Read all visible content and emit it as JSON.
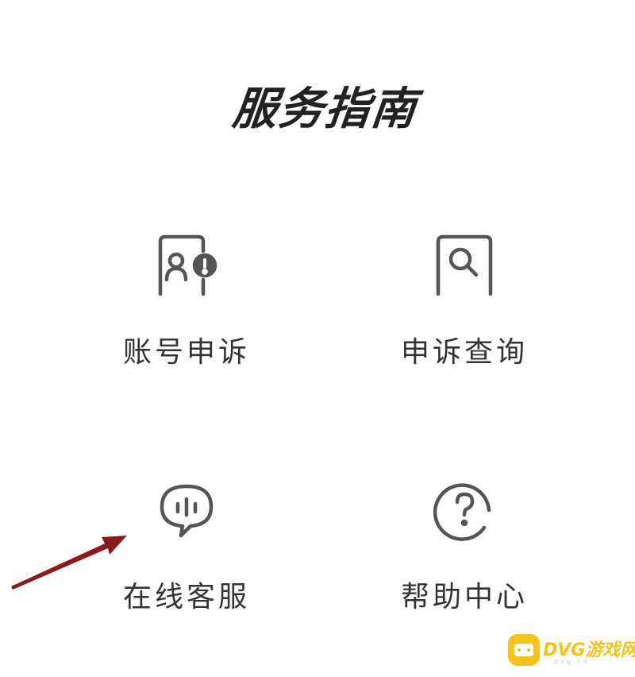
{
  "page": {
    "title": "服务指南"
  },
  "services": [
    {
      "label": "账号申诉",
      "icon": "account-appeal-icon"
    },
    {
      "label": "申诉查询",
      "icon": "appeal-search-icon"
    },
    {
      "label": "在线客服",
      "icon": "chat-bubble-icon"
    },
    {
      "label": "帮助中心",
      "icon": "question-mark-icon"
    }
  ],
  "annotation": {
    "icon": "red-arrow-icon",
    "color": "#8b1a1a"
  },
  "watermark": {
    "text": "DVG游戏网",
    "sub": "dvg.cn",
    "color": "#f6c31a"
  },
  "colors": {
    "icon_stroke": "#555555",
    "text": "#333333"
  }
}
